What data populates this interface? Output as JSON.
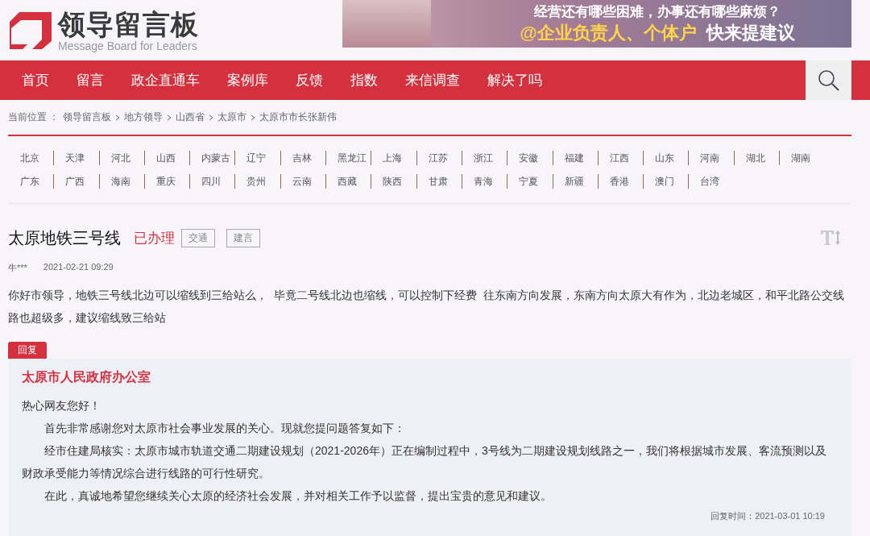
{
  "header": {
    "logo_title": "领导留言板",
    "logo_subtitle": "Message Board for Leaders",
    "banner": {
      "line_1": "经营还有哪些困难，办事还有哪些麻烦？",
      "line_2_highlight": "@企业负责人、个体户",
      "line_2": "快来提建议"
    }
  },
  "nav": {
    "items": [
      {
        "label": "首页"
      },
      {
        "label": "留言"
      },
      {
        "label": "政企直通车"
      },
      {
        "label": "案例库"
      },
      {
        "label": "反馈"
      },
      {
        "label": "指数"
      },
      {
        "label": "来信调查"
      },
      {
        "label": "解决了吗"
      }
    ]
  },
  "breadcrumb": {
    "label": "当前位置 ：",
    "items": [
      "领导留言板",
      "地方领导",
      "山西省",
      "太原市",
      "太原市市长张新伟"
    ]
  },
  "regions": [
    "北京",
    "天津",
    "河北",
    "山西",
    "内蒙古",
    "辽宁",
    "吉林",
    "黑龙江",
    "上海",
    "江苏",
    "浙江",
    "安徽",
    "福建",
    "江西",
    "山东",
    "河南",
    "湖北",
    "湖南",
    "广东",
    "广西",
    "海南",
    "重庆",
    "四川",
    "贵州",
    "云南",
    "西藏",
    "陕西",
    "甘肃",
    "青海",
    "宁夏",
    "新疆",
    "香港",
    "澳门",
    "台湾"
  ],
  "message": {
    "title": "太原地铁三号线",
    "status": "已办理",
    "tags": [
      "交通",
      "建言"
    ],
    "author": "牛***",
    "date": "2021-02-21 09:29",
    "body": "你好市领导，地铁三号线北边可以缩线到三给站么，  毕竟二号线北边也缩线，可以控制下经费  往东南方向发展，东南方向太原大有作为，北边老城区，和平北路公交线路也超级多，建议缩线致三给站"
  },
  "reply": {
    "tab": "回复",
    "organization": "太原市人民政府办公室",
    "greeting": "热心网友您好！",
    "paragraphs": [
      "首先非常感谢您对太原市社会事业发展的关心。现就您提问题答复如下：",
      "经市住建局核实：太原市城市轨道交通二期建设规划（2021-2026年）正在编制过程中，3号线为二期建设规划线路之一，我们将根据城市发展、客流预测以及财政承受能力等情况综合进行线路的可行性研究。",
      "在此，真诚地希望您继续关心太原的经济社会发展，并对相关工作予以监督，提出宝贵的意见和建议。"
    ],
    "time_label": "回复时间：",
    "time": "2021-03-01 10:19"
  }
}
